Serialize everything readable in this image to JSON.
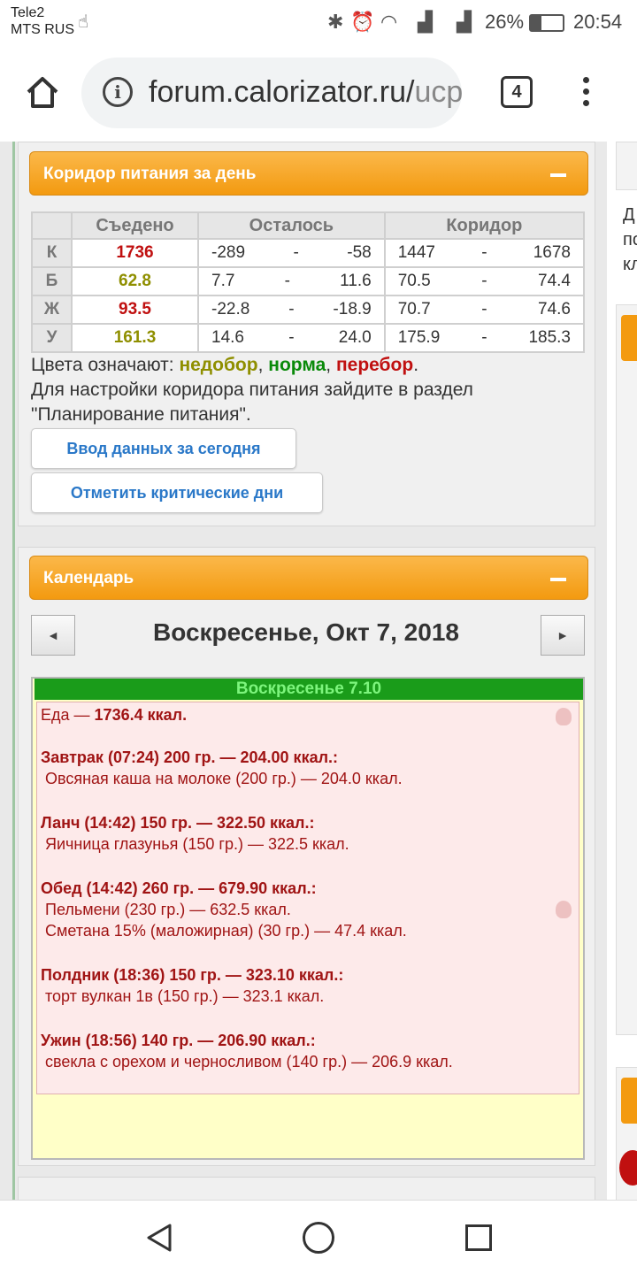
{
  "status_bar": {
    "carrier_1": "Tele2",
    "carrier_2": "MTS RUS",
    "battery": "26%",
    "time": "20:54"
  },
  "browser": {
    "url_main": "forum.calorizator.ru/",
    "url_rest": "ucр",
    "tab_count": "4"
  },
  "corridor_panel": {
    "title": "Коридор питания за день",
    "columns": [
      "",
      "Съедено",
      "Осталось",
      "Коридор"
    ],
    "rows": [
      {
        "label": "К",
        "eaten": "1736",
        "eaten_color": "#c01010",
        "left_from": "-289",
        "left_to": "-58",
        "range_from": "1447",
        "range_to": "1678"
      },
      {
        "label": "Б",
        "eaten": "62.8",
        "eaten_color": "#8f8f00",
        "left_from": "7.7",
        "left_to": "11.6",
        "range_from": "70.5",
        "range_to": "74.4"
      },
      {
        "label": "Ж",
        "eaten": "93.5",
        "eaten_color": "#c01010",
        "left_from": "-22.8",
        "left_to": "-18.9",
        "range_from": "70.7",
        "range_to": "74.6"
      },
      {
        "label": "У",
        "eaten": "161.3",
        "eaten_color": "#8f8f00",
        "left_from": "14.6",
        "left_to": "24.0",
        "range_from": "175.9",
        "range_to": "185.3"
      }
    ],
    "dash": "-",
    "legend_prefix": "Цвета означают:",
    "legend_under": "недобор",
    "legend_sep": ",",
    "legend_norm": "норма",
    "legend_over": "перебор",
    "legend_end": ".",
    "hint": "Для настройки коридора питания зайдите в раздел \"Планирование питания\".",
    "btn_enter": "Ввод данных за сегодня",
    "btn_critical": "Отметить критические дни"
  },
  "calendar_panel": {
    "title": "Календарь",
    "prev": "◄",
    "next": "►",
    "date_title": "Воскресенье, Окт 7, 2018",
    "day_bar": "Воскресенье 7.10",
    "food_total_label": "Еда —",
    "food_total_value": "1736.4 ккал.",
    "meals": [
      {
        "head": "Завтрак (07:24) 200 гр. — 204.00 ккал.:",
        "items": [
          "Овсяная каша на молоке (200 гр.) — 204.0 ккал."
        ]
      },
      {
        "head": "Ланч (14:42) 150 гр. — 322.50 ккал.:",
        "items": [
          "Яичница глазунья (150 гр.) — 322.5 ккал."
        ]
      },
      {
        "head": "Обед (14:42) 260 гр. — 679.90 ккал.:",
        "items": [
          "Пельмени (230 гр.) — 632.5 ккал.",
          "Сметана 15% (маложирная) (30 гр.) — 47.4 ккал."
        ]
      },
      {
        "head": "Полдник (18:36) 150 гр. — 323.10 ккал.:",
        "items": [
          "торт вулкан 1в (150 гр.) — 323.1 ккал."
        ]
      },
      {
        "head": "Ужин (18:56) 140 гр. — 206.90 ккал.:",
        "items": [
          "свекла с орехом и черносливом (140 гр.) — 206.9 ккал."
        ]
      }
    ]
  },
  "right_column": {
    "line1": "Д",
    "line2": "по",
    "line3": "кл"
  }
}
